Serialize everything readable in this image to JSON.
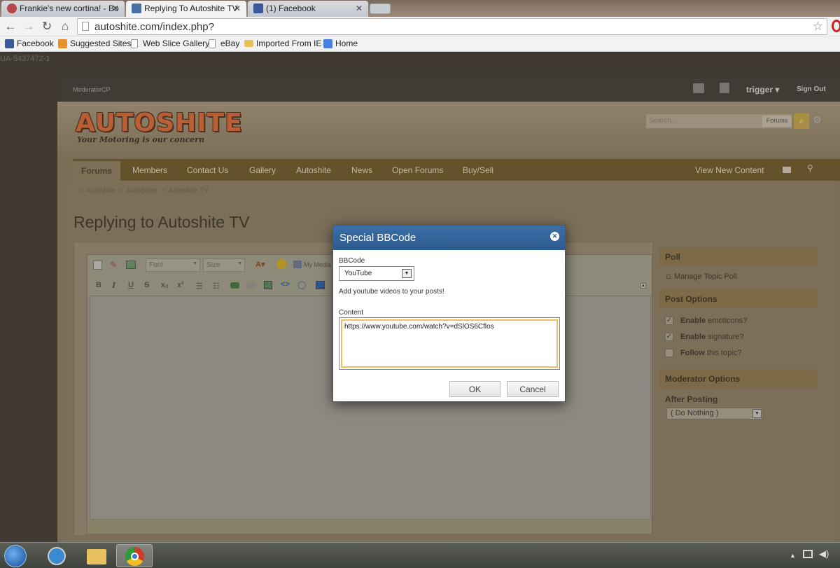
{
  "browser": {
    "tabs": [
      {
        "label": "Frankie's new cortina! - Bo",
        "fav_color": "#b5484a"
      },
      {
        "label": "Replying To Autoshite TV",
        "fav_color": "#4a6fa8"
      },
      {
        "label": "(1) Facebook",
        "fav_color": "#3b5998"
      }
    ],
    "url": "autoshite.com/index.php?",
    "bookmarks": [
      {
        "label": "Facebook",
        "icon": "facebook-icon",
        "color": "#3b5998"
      },
      {
        "label": "Suggested Sites",
        "icon": "suggested-sites-icon",
        "color": "#e8902a"
      },
      {
        "label": "Web Slice Gallery",
        "icon": "page-icon",
        "color": "#ffffff"
      },
      {
        "label": "eBay",
        "icon": "page-icon",
        "color": "#ffffff"
      },
      {
        "label": "Imported From IE",
        "icon": "folder-icon",
        "color": "#e8c050"
      },
      {
        "label": "Home",
        "icon": "google-icon",
        "color": "#4a7fe0"
      }
    ]
  },
  "ua_text": "UA-5437472-1",
  "site": {
    "modbar": {
      "label": "ModeratorCP",
      "user": "trigger",
      "sign_out": "Sign Out"
    },
    "logo": {
      "text": "AUTOSHITE",
      "tagline": "Your Motoring is our concern"
    },
    "search": {
      "placeholder": "Search...",
      "scope": "Forums"
    },
    "nav": {
      "items": [
        "Forums",
        "Members",
        "Contact Us",
        "Gallery",
        "Autoshite",
        "News",
        "Open Forums",
        "Buy/Sell"
      ],
      "right": "View New Content"
    },
    "breadcrumb": [
      ">",
      "Autoshite",
      ">",
      "AutoShite",
      ">",
      "Autoshite TV"
    ],
    "page_title": "Replying to Autoshite TV",
    "editor": {
      "font_select": "Font",
      "size_select": "Size",
      "my_media": "My Media",
      "format_buttons": [
        "B",
        "I",
        "U",
        "S",
        "x₂",
        "x²"
      ]
    },
    "sidebar": {
      "poll_head": "Poll",
      "manage_poll": "Manage Topic Poll",
      "options_head": "Post Options",
      "options": [
        {
          "bold": "Enable",
          "rest": " emoticons?",
          "checked": true
        },
        {
          "bold": "Enable",
          "rest": " signature?",
          "checked": true
        },
        {
          "bold": "Follow",
          "rest": " this topic?",
          "checked": false
        }
      ],
      "mod_head": "Moderator Options",
      "after_posting": "After Posting",
      "after_posting_value": "( Do Nothing )"
    }
  },
  "modal": {
    "title": "Special BBCode",
    "bbcode_label": "BBCode",
    "bbcode_value": "YouTube",
    "description": "Add youtube videos to your posts!",
    "content_label": "Content",
    "content_value": "https://www.youtube.com/watch?v=dSlOS6Cflos",
    "ok": "OK",
    "cancel": "Cancel"
  }
}
